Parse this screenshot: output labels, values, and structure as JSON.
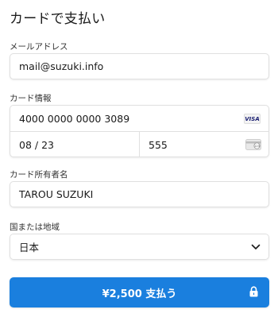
{
  "title": "カードで支払い",
  "email": {
    "label": "メールアドレス",
    "value": "mail@suzuki.info"
  },
  "card": {
    "label": "カード情報",
    "number": "4000 0000 0000 3089",
    "brand": "VISA",
    "expiry": "08 / 23",
    "cvc": "555"
  },
  "holder": {
    "label": "カード所有者名",
    "value": "TAROU SUZUKI"
  },
  "country": {
    "label": "国または地域",
    "value": "日本"
  },
  "pay_button": {
    "label": "¥2,500 支払う"
  },
  "colors": {
    "accent": "#1a7fde",
    "border": "#e0e0e0"
  },
  "icons": {
    "brand": "visa-icon",
    "cvc": "cvc-card-icon",
    "select": "chevron-down-icon",
    "pay": "lock-icon"
  }
}
